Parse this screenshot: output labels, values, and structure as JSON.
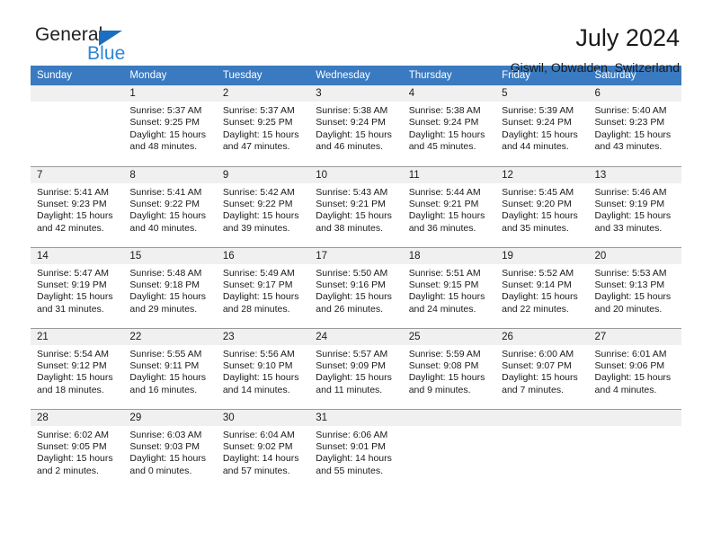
{
  "brand": {
    "name_top": "General",
    "name_bottom": "Blue",
    "triangle_color": "#1b6fc0",
    "blue_color": "#2f86d2"
  },
  "header": {
    "title": "July 2024",
    "subtitle": "Giswil, Obwalden, Switzerland"
  },
  "calendar": {
    "header_bg": "#3a7ac0",
    "header_text_color": "#ffffff",
    "daynum_bg": "#f0f0f0",
    "weekdays": [
      "Sunday",
      "Monday",
      "Tuesday",
      "Wednesday",
      "Thursday",
      "Friday",
      "Saturday"
    ],
    "weeks": [
      [
        {
          "day": "",
          "sunrise": "",
          "sunset": "",
          "daylight": "",
          "empty": true
        },
        {
          "day": "1",
          "sunrise": "Sunrise: 5:37 AM",
          "sunset": "Sunset: 9:25 PM",
          "daylight": "Daylight: 15 hours and 48 minutes."
        },
        {
          "day": "2",
          "sunrise": "Sunrise: 5:37 AM",
          "sunset": "Sunset: 9:25 PM",
          "daylight": "Daylight: 15 hours and 47 minutes."
        },
        {
          "day": "3",
          "sunrise": "Sunrise: 5:38 AM",
          "sunset": "Sunset: 9:24 PM",
          "daylight": "Daylight: 15 hours and 46 minutes."
        },
        {
          "day": "4",
          "sunrise": "Sunrise: 5:38 AM",
          "sunset": "Sunset: 9:24 PM",
          "daylight": "Daylight: 15 hours and 45 minutes."
        },
        {
          "day": "5",
          "sunrise": "Sunrise: 5:39 AM",
          "sunset": "Sunset: 9:24 PM",
          "daylight": "Daylight: 15 hours and 44 minutes."
        },
        {
          "day": "6",
          "sunrise": "Sunrise: 5:40 AM",
          "sunset": "Sunset: 9:23 PM",
          "daylight": "Daylight: 15 hours and 43 minutes."
        }
      ],
      [
        {
          "day": "7",
          "sunrise": "Sunrise: 5:41 AM",
          "sunset": "Sunset: 9:23 PM",
          "daylight": "Daylight: 15 hours and 42 minutes."
        },
        {
          "day": "8",
          "sunrise": "Sunrise: 5:41 AM",
          "sunset": "Sunset: 9:22 PM",
          "daylight": "Daylight: 15 hours and 40 minutes."
        },
        {
          "day": "9",
          "sunrise": "Sunrise: 5:42 AM",
          "sunset": "Sunset: 9:22 PM",
          "daylight": "Daylight: 15 hours and 39 minutes."
        },
        {
          "day": "10",
          "sunrise": "Sunrise: 5:43 AM",
          "sunset": "Sunset: 9:21 PM",
          "daylight": "Daylight: 15 hours and 38 minutes."
        },
        {
          "day": "11",
          "sunrise": "Sunrise: 5:44 AM",
          "sunset": "Sunset: 9:21 PM",
          "daylight": "Daylight: 15 hours and 36 minutes."
        },
        {
          "day": "12",
          "sunrise": "Sunrise: 5:45 AM",
          "sunset": "Sunset: 9:20 PM",
          "daylight": "Daylight: 15 hours and 35 minutes."
        },
        {
          "day": "13",
          "sunrise": "Sunrise: 5:46 AM",
          "sunset": "Sunset: 9:19 PM",
          "daylight": "Daylight: 15 hours and 33 minutes."
        }
      ],
      [
        {
          "day": "14",
          "sunrise": "Sunrise: 5:47 AM",
          "sunset": "Sunset: 9:19 PM",
          "daylight": "Daylight: 15 hours and 31 minutes."
        },
        {
          "day": "15",
          "sunrise": "Sunrise: 5:48 AM",
          "sunset": "Sunset: 9:18 PM",
          "daylight": "Daylight: 15 hours and 29 minutes."
        },
        {
          "day": "16",
          "sunrise": "Sunrise: 5:49 AM",
          "sunset": "Sunset: 9:17 PM",
          "daylight": "Daylight: 15 hours and 28 minutes."
        },
        {
          "day": "17",
          "sunrise": "Sunrise: 5:50 AM",
          "sunset": "Sunset: 9:16 PM",
          "daylight": "Daylight: 15 hours and 26 minutes."
        },
        {
          "day": "18",
          "sunrise": "Sunrise: 5:51 AM",
          "sunset": "Sunset: 9:15 PM",
          "daylight": "Daylight: 15 hours and 24 minutes."
        },
        {
          "day": "19",
          "sunrise": "Sunrise: 5:52 AM",
          "sunset": "Sunset: 9:14 PM",
          "daylight": "Daylight: 15 hours and 22 minutes."
        },
        {
          "day": "20",
          "sunrise": "Sunrise: 5:53 AM",
          "sunset": "Sunset: 9:13 PM",
          "daylight": "Daylight: 15 hours and 20 minutes."
        }
      ],
      [
        {
          "day": "21",
          "sunrise": "Sunrise: 5:54 AM",
          "sunset": "Sunset: 9:12 PM",
          "daylight": "Daylight: 15 hours and 18 minutes."
        },
        {
          "day": "22",
          "sunrise": "Sunrise: 5:55 AM",
          "sunset": "Sunset: 9:11 PM",
          "daylight": "Daylight: 15 hours and 16 minutes."
        },
        {
          "day": "23",
          "sunrise": "Sunrise: 5:56 AM",
          "sunset": "Sunset: 9:10 PM",
          "daylight": "Daylight: 15 hours and 14 minutes."
        },
        {
          "day": "24",
          "sunrise": "Sunrise: 5:57 AM",
          "sunset": "Sunset: 9:09 PM",
          "daylight": "Daylight: 15 hours and 11 minutes."
        },
        {
          "day": "25",
          "sunrise": "Sunrise: 5:59 AM",
          "sunset": "Sunset: 9:08 PM",
          "daylight": "Daylight: 15 hours and 9 minutes."
        },
        {
          "day": "26",
          "sunrise": "Sunrise: 6:00 AM",
          "sunset": "Sunset: 9:07 PM",
          "daylight": "Daylight: 15 hours and 7 minutes."
        },
        {
          "day": "27",
          "sunrise": "Sunrise: 6:01 AM",
          "sunset": "Sunset: 9:06 PM",
          "daylight": "Daylight: 15 hours and 4 minutes."
        }
      ],
      [
        {
          "day": "28",
          "sunrise": "Sunrise: 6:02 AM",
          "sunset": "Sunset: 9:05 PM",
          "daylight": "Daylight: 15 hours and 2 minutes."
        },
        {
          "day": "29",
          "sunrise": "Sunrise: 6:03 AM",
          "sunset": "Sunset: 9:03 PM",
          "daylight": "Daylight: 15 hours and 0 minutes."
        },
        {
          "day": "30",
          "sunrise": "Sunrise: 6:04 AM",
          "sunset": "Sunset: 9:02 PM",
          "daylight": "Daylight: 14 hours and 57 minutes."
        },
        {
          "day": "31",
          "sunrise": "Sunrise: 6:06 AM",
          "sunset": "Sunset: 9:01 PM",
          "daylight": "Daylight: 14 hours and 55 minutes."
        },
        {
          "day": "",
          "sunrise": "",
          "sunset": "",
          "daylight": "",
          "empty": true,
          "blank": true
        },
        {
          "day": "",
          "sunrise": "",
          "sunset": "",
          "daylight": "",
          "empty": true,
          "blank": true
        },
        {
          "day": "",
          "sunrise": "",
          "sunset": "",
          "daylight": "",
          "empty": true,
          "blank": true
        }
      ]
    ]
  }
}
